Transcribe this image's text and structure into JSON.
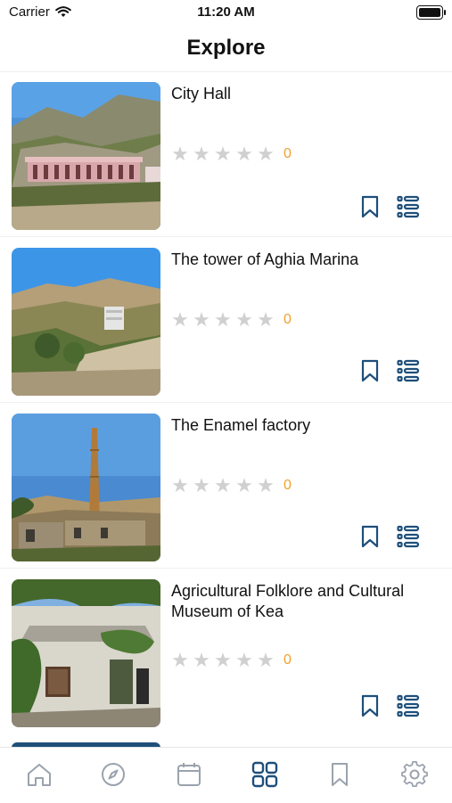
{
  "status_bar": {
    "carrier": "Carrier",
    "time": "11:20 AM"
  },
  "nav": {
    "title": "Explore"
  },
  "items": [
    {
      "name": "City Hall",
      "rating": "0",
      "stars_total": 5,
      "image": "city-hall-photo"
    },
    {
      "name": "The tower of Aghia Marina",
      "rating": "0",
      "stars_total": 5,
      "image": "tower-photo"
    },
    {
      "name": "The Enamel factory",
      "rating": "0",
      "stars_total": 5,
      "image": "factory-photo"
    },
    {
      "name": "Agricultural Folklore and Cultural Museum of Kea",
      "rating": "0",
      "stars_total": 5,
      "image": "museum-photo"
    }
  ],
  "tabs": [
    {
      "name": "home",
      "icon": "home-icon",
      "active": false
    },
    {
      "name": "explore-compass",
      "icon": "compass-icon",
      "active": false
    },
    {
      "name": "calendar",
      "icon": "calendar-icon",
      "active": false
    },
    {
      "name": "grid",
      "icon": "grid-icon",
      "active": true
    },
    {
      "name": "bookmarks",
      "icon": "bookmark-icon",
      "active": false
    },
    {
      "name": "settings",
      "icon": "gear-icon",
      "active": false
    }
  ],
  "colors": {
    "accent": "#1e4f7b",
    "inactive": "#9aa3ad",
    "star": "#d0d0d0",
    "rating": "#f0a030"
  }
}
